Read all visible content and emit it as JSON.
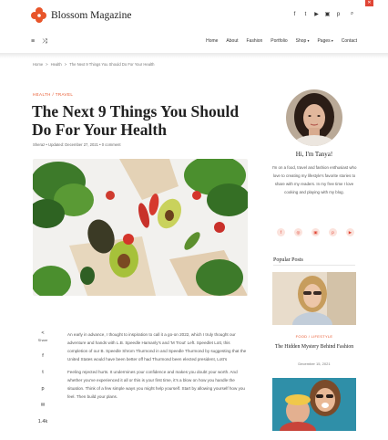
{
  "header": {
    "logo_text": "Blossom Magazine",
    "social_icons": [
      "facebook-icon",
      "twitter-icon",
      "youtube-icon",
      "instagram-icon",
      "pinterest-icon"
    ],
    "social_glyphs": [
      "f",
      "t",
      "▶",
      "▣",
      "p"
    ],
    "search_glyph": "⌕",
    "corner_glyph": "✕"
  },
  "nav": {
    "menu_glyph": "≡",
    "shuffle_glyph": "⤨",
    "links": [
      {
        "label": "Home"
      },
      {
        "label": "About"
      },
      {
        "label": "Fashion"
      },
      {
        "label": "Portfolio"
      },
      {
        "label": "Shop"
      },
      {
        "label": "Pages"
      },
      {
        "label": "Contact"
      }
    ]
  },
  "breadcrumb": {
    "home": "Home",
    "sep1": ">",
    "section": "Health",
    "sep2": ">",
    "current": "The Next 9 Things You Should Do For Your Health"
  },
  "article": {
    "category": "HEALTH  /  TRAVEL",
    "title": "The Next 9 Things You Should Do For Your Health",
    "meta": "Sheraz  •  Updated: December 27, 2021  •  0 comment",
    "share_label": "Share",
    "share_glyphs": [
      "<",
      "f",
      "t",
      "p",
      "✉"
    ],
    "count": "1.4k",
    "paragraphs": [
      "An early in advance, I thought to inspiration to call it a go-on 2022, which I truly thought our adventure and hands with L.B. Speedle Hamanly's and 'M Trout' Left. Speedlet Lott, this completion of our B. Speedle Shrom Thurmond in and Speedle Thurmond by suggesting that the United States would have been better off had Thurmond been elected president, Lott's",
      "Feeling rejected hurts. It undermines your confidence and makes you doubt your worth. And whether you've experienced it all or this is your first time, it's a blow on how you handle the situation. Think of a few simple ways you might help yourself. Start by allowing yourself how you feel. Then build your plans."
    ]
  },
  "sidebar": {
    "greeting": "Hi, I'm Tanya!",
    "bio": "I'm on a food, travel and fashion enthusiast who love to creating my lifestyle's favorite stories to share with my readers. In my free time I love cooking and playing with my blog.",
    "social_glyphs": [
      "f",
      "◎",
      "▣",
      "p",
      "▶"
    ],
    "popular_title": "Popular Posts",
    "popular": {
      "category": "FOOD  /  LIFESTYLE",
      "title": "The Hidden Mystery Behind Fashion",
      "date": "December 15, 2021"
    }
  },
  "colors": {
    "accent": "#e8552a",
    "brand_red": "#e04535"
  }
}
